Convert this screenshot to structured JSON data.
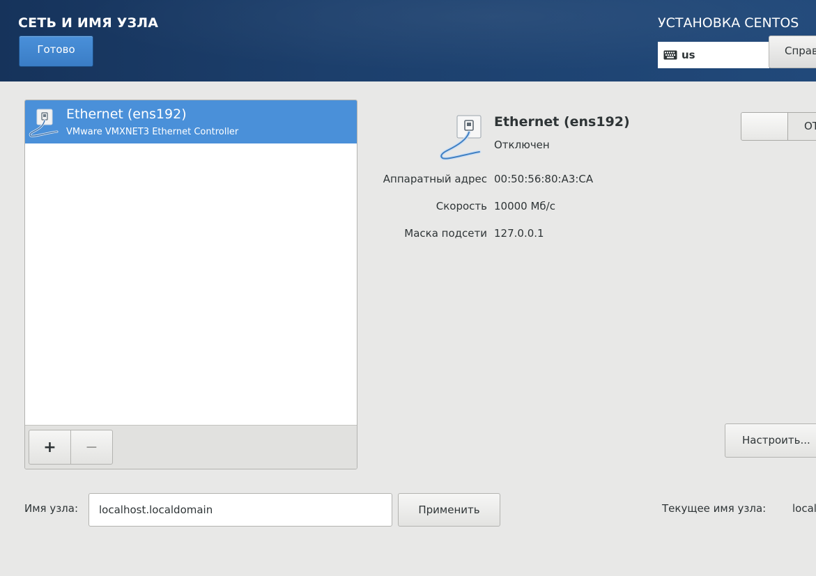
{
  "header": {
    "title": "СЕТЬ И ИМЯ УЗЛА",
    "done_label": "Готово",
    "install_title": "УСТАНОВКА CENTOS",
    "keyboard_layout": "us",
    "help_label": "Справка!"
  },
  "device_list": {
    "items": [
      {
        "title": "Ethernet (ens192)",
        "subtitle": "VMware VMXNET3 Ethernet Controller",
        "selected": true,
        "icon": "network-wired-icon"
      }
    ],
    "add_label": "+",
    "remove_label": "−"
  },
  "details": {
    "name": "Ethernet (ens192)",
    "status": "Отключен",
    "toggle_label": "ОТКЛ",
    "rows": [
      {
        "label": "Аппаратный адрес",
        "value": "00:50:56:80:A3:CA"
      },
      {
        "label": "Скорость",
        "value": "10000 Мб/с"
      },
      {
        "label": "Маска подсети",
        "value": "127.0.0.1"
      }
    ],
    "configure_label": "Настроить..."
  },
  "hostname": {
    "label": "Имя узла:",
    "value": "localhost.localdomain",
    "apply_label": "Применить",
    "current_label": "Текущее имя узла:",
    "current_value": "localhost"
  },
  "colors": {
    "header_bg": "#1c3f6c",
    "accent": "#4a90d9",
    "page_bg": "#e8e8e7"
  }
}
